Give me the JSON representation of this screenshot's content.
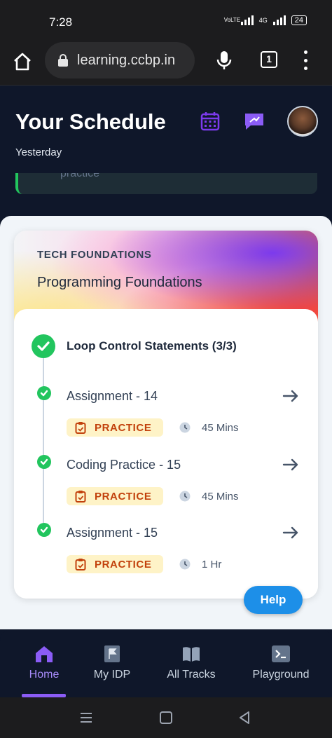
{
  "status_bar": {
    "time": "7:28",
    "network_label": "VoLTE",
    "network_4g": "4G",
    "battery": "24"
  },
  "browser": {
    "url": "learning.ccbp.in",
    "tabs_count": "1"
  },
  "header": {
    "title": "Your Schedule",
    "subtitle": "Yesterday",
    "previous_card_text": "practice"
  },
  "course": {
    "track": "TECH FOUNDATIONS",
    "name": "Programming Foundations",
    "topic": "Loop Control Statements (3/3)",
    "items": [
      {
        "title": "Assignment - 14",
        "badge": "PRACTICE",
        "duration": "45 Mins"
      },
      {
        "title": "Coding Practice - 15",
        "badge": "PRACTICE",
        "duration": "45 Mins"
      },
      {
        "title": "Assignment - 15",
        "badge": "PRACTICE",
        "duration": "1 Hr"
      }
    ]
  },
  "help_label": "Help",
  "bottom_nav": {
    "items": [
      {
        "label": "Home",
        "active": true
      },
      {
        "label": "My IDP",
        "active": false
      },
      {
        "label": "All Tracks",
        "active": false
      },
      {
        "label": "Playground",
        "active": false
      }
    ]
  },
  "colors": {
    "accent": "#8b5cf6",
    "success": "#22c55e",
    "help": "#1d8fe8",
    "badge_bg": "#fef3c7",
    "badge_text": "#c2410c"
  }
}
